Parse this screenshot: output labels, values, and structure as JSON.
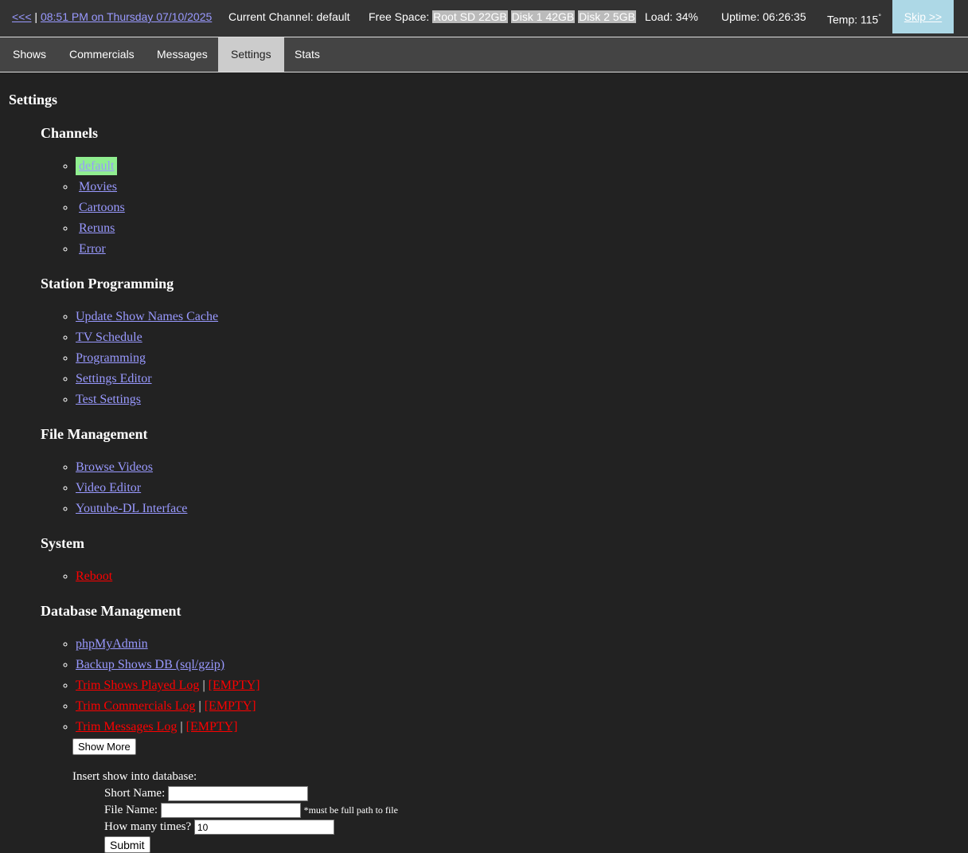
{
  "topbar": {
    "back_link": "<<<",
    "separator": "|",
    "datetime": "08:51 PM on Thursday 07/10/2025",
    "current_channel": "Current Channel: default",
    "free_space_label": "Free Space:",
    "disks": [
      "Root SD 22GB",
      "Disk 1 42GB",
      "Disk 2 5GB"
    ],
    "load": "Load: 34%",
    "uptime": "Uptime: 06:26:35",
    "temp": "Temp: 115",
    "temp_unit": "°",
    "skip": "Skip >>"
  },
  "tabs": [
    "Shows",
    "Commercials",
    "Messages",
    "Settings",
    "Stats"
  ],
  "active_tab": "Settings",
  "page_title": "Settings",
  "channels": {
    "heading": "Channels",
    "items": [
      "default",
      "Movies",
      "Cartoons",
      "Reruns",
      "Error"
    ]
  },
  "station_programming": {
    "heading": "Station Programming",
    "items": [
      "Update Show Names Cache",
      "TV Schedule",
      "Programming",
      "Settings Editor",
      "Test Settings"
    ]
  },
  "file_management": {
    "heading": "File Management",
    "items": [
      "Browse Videos",
      "Video Editor",
      "Youtube-DL Interface"
    ]
  },
  "system": {
    "heading": "System",
    "items": [
      "Reboot"
    ]
  },
  "database": {
    "heading": "Database Management",
    "items": [
      "phpMyAdmin",
      "Backup Shows DB (sql/gzip)"
    ],
    "trim_items": [
      "Trim Shows Played Log",
      "Trim Commercials Log",
      "Trim Messages Log"
    ],
    "empty_label": "[EMPTY]",
    "separator": "|",
    "show_more": "Show More"
  },
  "insert_form": {
    "title": "Insert show into database:",
    "short_name_label": "Short Name:",
    "short_name_value": "",
    "file_name_label": "File Name:",
    "file_name_value": "",
    "file_name_note": "*must be full path to file",
    "times_label": "How many times?",
    "times_value": "10",
    "submit": "Submit"
  },
  "colors": {
    "background": "#222222",
    "link": "#9999ff",
    "danger": "#ff0000",
    "current_channel_highlight": "#90ee90",
    "skip_button": "#add8e6"
  }
}
